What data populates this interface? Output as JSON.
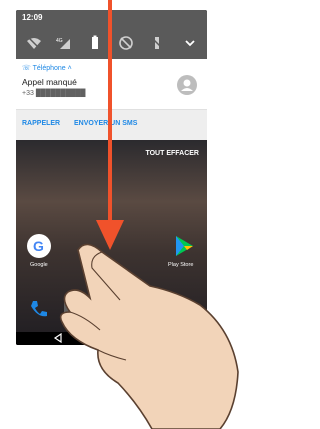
{
  "status": {
    "time": "12:09",
    "network": "4G"
  },
  "notification": {
    "app_name": "Téléphone",
    "title": "Appel manqué",
    "number": "+33 ██████████"
  },
  "actions": {
    "call_back": "RAPPELER",
    "send_sms": "ENVOYER UN SMS"
  },
  "home": {
    "clear_all": "TOUT EFFACER",
    "app_google": "Google",
    "app_playstore": "Play Store"
  },
  "colors": {
    "accent": "#1e88e5",
    "arrow": "#f0522b",
    "shade": "#5a5a5a"
  }
}
